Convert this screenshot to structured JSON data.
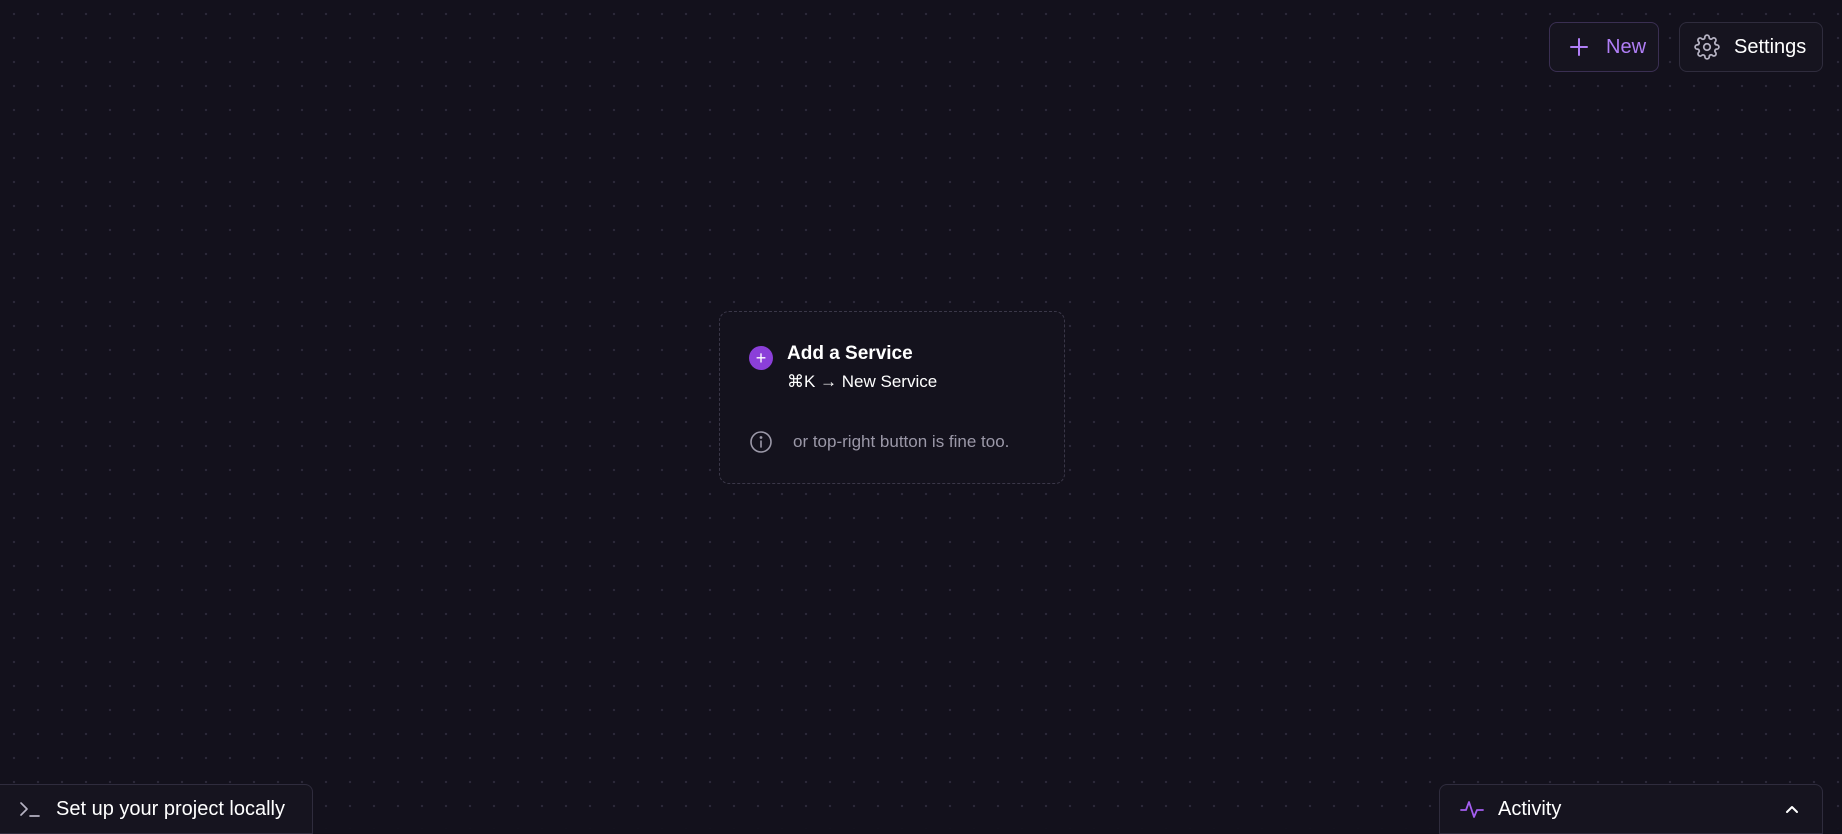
{
  "toolbar": {
    "new_label": "New",
    "settings_label": "Settings"
  },
  "empty_state": {
    "title": "Add a Service",
    "shortcut": "⌘K → New Service",
    "hint": "or top-right button is fine too.",
    "add_symbol": "+"
  },
  "footer": {
    "local_setup_label": "Set up your project locally",
    "activity_label": "Activity"
  },
  "icons": {
    "new": "plus-icon",
    "settings": "gear-icon",
    "info": "info-icon",
    "terminal": "terminal-icon",
    "activity": "activity-pulse-icon",
    "expand": "chevron-up-icon"
  },
  "colors": {
    "background": "#13111c",
    "accent": "#8b3fd9",
    "accent_text": "#b07ef6",
    "border": "#2f2c3d",
    "muted_text": "#9b98a8"
  }
}
